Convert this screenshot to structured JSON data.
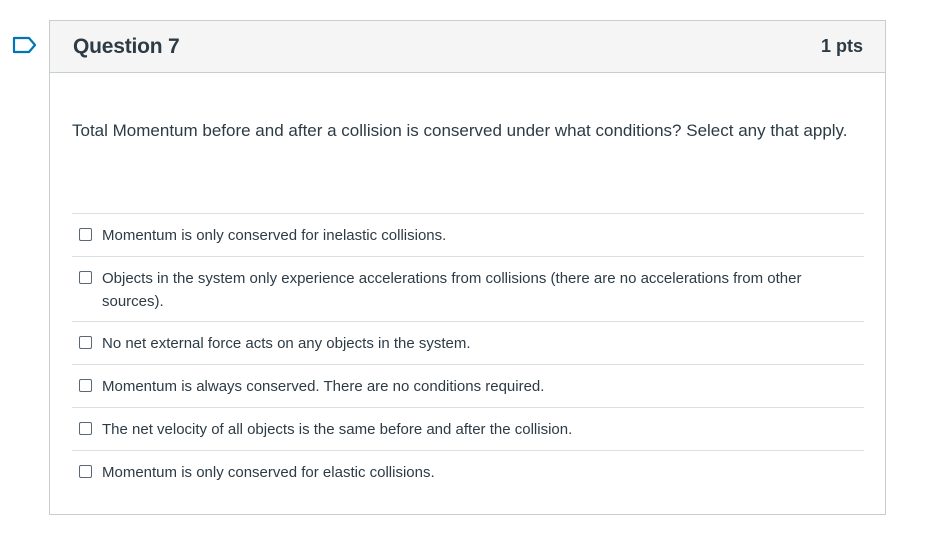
{
  "question": {
    "title": "Question 7",
    "points": "1 pts",
    "text": "Total Momentum before and after a collision is conserved under what conditions? Select any that apply.",
    "flag_icon": "flag-bookmark-icon",
    "accent_color": "#0374b5"
  },
  "answers": [
    {
      "label": "Momentum is only conserved for inelastic collisions.",
      "checked": false
    },
    {
      "label": "Objects in the system only experience accelerations from collisions (there are no accelerations from other sources).",
      "checked": false
    },
    {
      "label": "No net external force acts on any objects in the system.",
      "checked": false
    },
    {
      "label": "Momentum is always conserved. There are no conditions required.",
      "checked": false
    },
    {
      "label": "The net velocity of all objects is the same before and after the collision.",
      "checked": false
    },
    {
      "label": "Momentum is only conserved for elastic collisions.",
      "checked": false
    }
  ]
}
